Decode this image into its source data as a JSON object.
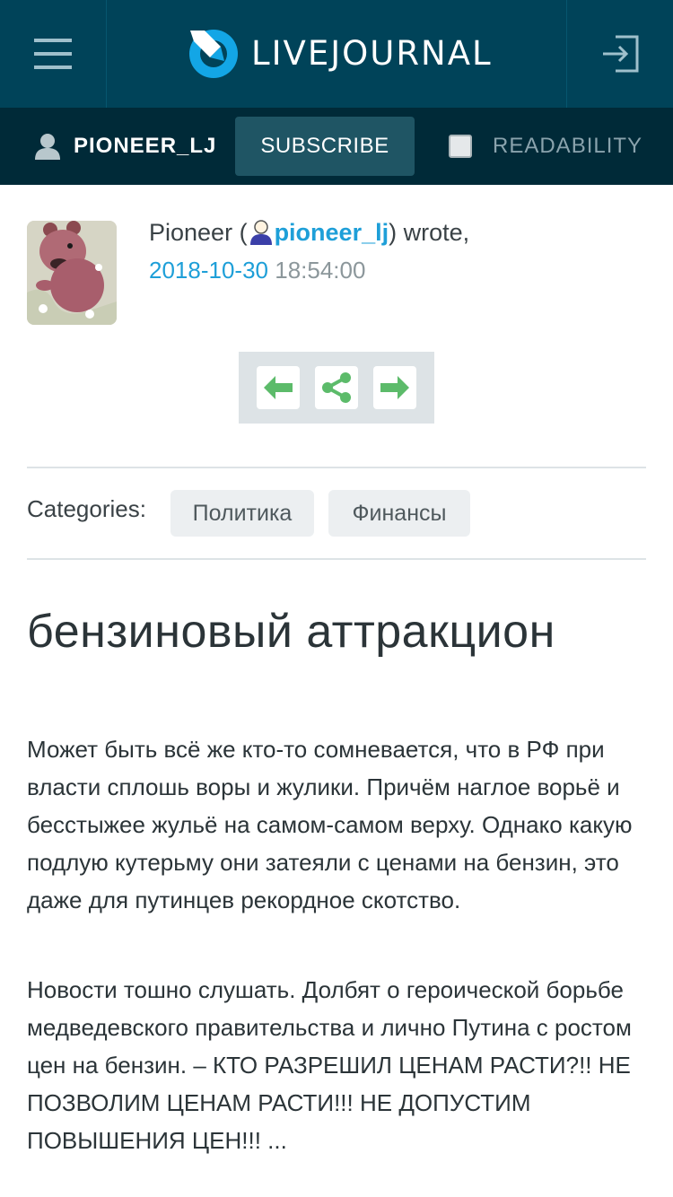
{
  "header": {
    "logo_text": "LIVEJOURNAL",
    "menu_icon": "hamburger-menu-icon",
    "login_icon": "login-icon",
    "bg_color": "#004359"
  },
  "subbar": {
    "username": "PIONEER_LJ",
    "subscribe_label": "SUBSCRIBE",
    "readability_label": "READABILITY",
    "bg_color": "#002a38"
  },
  "post": {
    "author_display": "Pioneer (",
    "author_username": "pioneer_lj",
    "wrote_suffix": ") wrote,",
    "date": "2018-10-30",
    "time": "18:54:00",
    "categories_label": "Categories:",
    "categories": [
      "Политика",
      "Финансы"
    ],
    "title": "бензиновый аттракцион",
    "paragraphs": [
      "Может быть всё же кто-то сомневается, что в РФ при власти сплошь воры и жулики. Причём наглое ворьё и бесстыжее жульё на самом-самом верху. Однако какую подлую кутерьму они затеяли с ценами на бензин, это даже для путинцев рекордное скотство.",
      "Новости тошно слушать. Долбят о героической борьбе медведевского правительства и лично Путина с ростом цен на бензин. – КТО РАЗРЕШИЛ ЦЕНАМ РАСТИ?!! НЕ ПОЗВОЛИМ ЦЕНАМ РАСТИ!!! НЕ ДОПУСТИМ ПОВЫШЕНИЯ ЦЕН!!! ..."
    ]
  },
  "colors": {
    "link": "#1e9fd8",
    "nav_arrow": "#5cbb6a"
  }
}
